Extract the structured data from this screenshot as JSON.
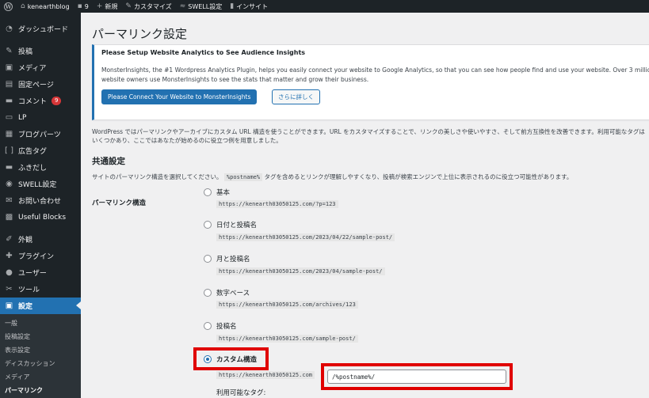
{
  "adminbar": {
    "site_name": "kenearthblog",
    "comments_count": "9",
    "new_label": "新規",
    "customize_label": "カスタマイズ",
    "swell_label": "SWELL設定",
    "insights_label": "インサイト"
  },
  "sidebar": {
    "items": [
      {
        "label": "ダッシュボード",
        "icon": "dashboard-icon"
      },
      {
        "label": "投稿",
        "icon": "pin-icon"
      },
      {
        "label": "メディア",
        "icon": "media-icon"
      },
      {
        "label": "固定ページ",
        "icon": "page-icon"
      },
      {
        "label": "コメント",
        "icon": "comment-icon",
        "badge": "9"
      },
      {
        "label": "LP",
        "icon": "lp-icon"
      },
      {
        "label": "ブログパーツ",
        "icon": "blog-parts-icon"
      },
      {
        "label": "広告タグ",
        "icon": "ad-tag-icon"
      },
      {
        "label": "ふきだし",
        "icon": "speech-bubble-icon"
      },
      {
        "label": "SWELL設定",
        "icon": "swell-icon"
      },
      {
        "label": "お問い合わせ",
        "icon": "mail-icon"
      },
      {
        "label": "Useful Blocks",
        "icon": "blocks-icon"
      },
      {
        "label": "外観",
        "icon": "appearance-icon"
      },
      {
        "label": "プラグイン",
        "icon": "plugin-icon"
      },
      {
        "label": "ユーザー",
        "icon": "user-icon"
      },
      {
        "label": "ツール",
        "icon": "tool-icon"
      },
      {
        "label": "設定",
        "icon": "settings-icon",
        "current": true
      }
    ],
    "submenu": [
      "一般",
      "投稿設定",
      "表示設定",
      "ディスカッション",
      "メディア",
      "パーマリンク"
    ]
  },
  "page": {
    "title": "パーマリンク設定",
    "notice": {
      "title": "Please Setup Website Analytics to See Audience Insights",
      "text": "MonsterInsights, the #1 Wordpress Analytics Plugin, helps you easily connect your website to Google Analytics, so that you can see how people find and use your website. Over 3 million website owners use MonsterInsights to see the stats that matter and grow their business.",
      "primary_button": "Please Connect Your Website to MonsterInsights",
      "secondary_button": "さらに詳しく"
    },
    "intro": "WordPress ではパーマリンクやアーカイブにカスタム URL 構造を使うことができます。URL をカスタマイズすることで、リンクの美しさや使いやすさ、そして前方互換性を改善できます。利用可能なタグはいくつかあり、ここではあなたが始めるのに役立つ例を用意しました。",
    "section_title": "共通設定",
    "section_desc_before": "サイトのパーマリンク構造を選択してください。",
    "section_desc_code": "%postname%",
    "section_desc_after": "タグを含めるとリンクが理解しやすくなり、投稿が検索エンジンで上位に表示されるのに役立つ可能性があります。",
    "row_label": "パーマリンク構造",
    "options": [
      {
        "label": "基本",
        "sample": "https://kenearth03050125.com/?p=123",
        "checked": false
      },
      {
        "label": "日付と投稿名",
        "sample": "https://kenearth03050125.com/2023/04/22/sample-post/",
        "checked": false
      },
      {
        "label": "月と投稿名",
        "sample": "https://kenearth03050125.com/2023/04/sample-post/",
        "checked": false
      },
      {
        "label": "数字ベース",
        "sample": "https://kenearth03050125.com/archives/123",
        "checked": false
      },
      {
        "label": "投稿名",
        "sample": "https://kenearth03050125.com/sample-post/",
        "checked": false
      },
      {
        "label": "カスタム構造",
        "sample": "https://kenearth03050125.com",
        "checked": true
      }
    ],
    "custom_value": "/%postname%/",
    "tags_label": "利用可能なタグ:"
  },
  "colors": {
    "admin_dark": "#1d2327",
    "accent": "#2271b1",
    "highlight": "#e00000"
  }
}
